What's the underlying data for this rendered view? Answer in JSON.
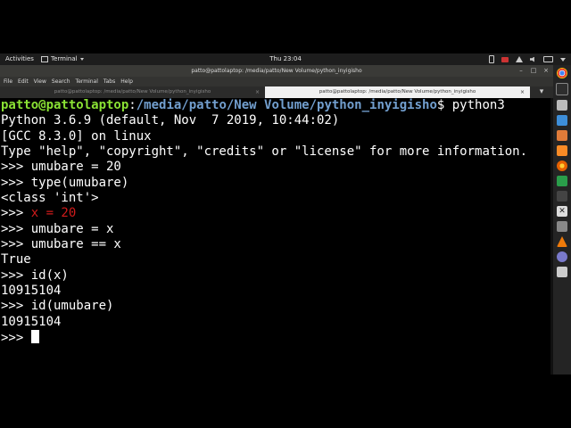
{
  "topbar": {
    "activities": "Activities",
    "app_menu": "Terminal",
    "clock": "Thu 23:04"
  },
  "window": {
    "title": "patto@pattolaptop: /media/patto/New Volume/python_inyigisho",
    "menu": [
      "File",
      "Edit",
      "View",
      "Search",
      "Terminal",
      "Tabs",
      "Help"
    ],
    "tabs": [
      {
        "label": "patto@pattolaptop: /media/patto/New Volume/python_inyigisho",
        "active": false
      },
      {
        "label": "patto@pattolaptop: /media/patto/New Volume/python_inyigisho",
        "active": true
      }
    ]
  },
  "terminal": {
    "prompt_user": "patto@pattolaptop",
    "prompt_path": "/media/patto/New Volume/python_inyigisho",
    "prompt_cmd": "$ python3",
    "lines": [
      "Python 3.6.9 (default, Nov  7 2019, 10:44:02)",
      "[GCC 8.3.0] on linux",
      "Type \"help\", \"copyright\", \"credits\" or \"license\" for more information.",
      ">>> umubare = 20",
      ">>> type(umubare)",
      "<class 'int'>"
    ],
    "red_prompt": ">>> ",
    "red_text": "x = 20",
    "lines2": [
      ">>> umubare = x",
      ">>> umubare == x",
      "True",
      ">>> id(x)",
      "10915104",
      ">>> id(umubare)",
      "10915104"
    ],
    "last_prompt": ">>> "
  },
  "dock": [
    "chrome-icon",
    "terminal-icon",
    "files-icon",
    "virtualbox-icon",
    "presentation-icon",
    "sublime-icon",
    "firefox-icon",
    "spreadsheet-icon",
    "eye-icon",
    "x-icon",
    "screenshot-icon",
    "vlc-icon",
    "microphone-icon",
    "code-icon"
  ]
}
